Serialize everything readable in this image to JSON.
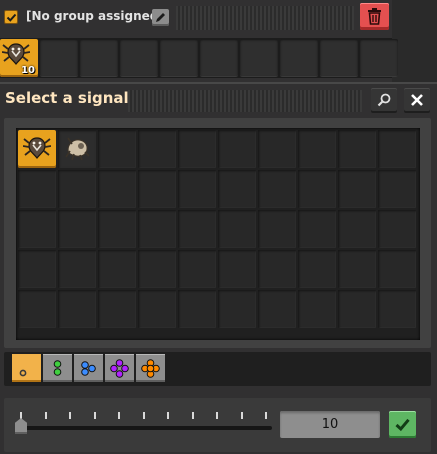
{
  "background": {
    "group": {
      "checked": true,
      "label": "[No group assigned]",
      "edit_icon": "pencil-icon",
      "delete_icon": "trash-icon"
    },
    "slots": [
      {
        "icon": "biter-signal-icon",
        "count": "10",
        "active": true
      },
      {},
      {},
      {},
      {},
      {},
      {},
      {},
      {},
      {}
    ]
  },
  "dialog": {
    "title": "Select a signal",
    "search_icon": "search-icon",
    "close_icon": "close-icon",
    "signals": [
      {
        "icon": "biter-signal-icon",
        "active": true
      },
      {
        "icon": "spitter-signal-icon",
        "active": false
      }
    ],
    "grid": {
      "columns": 10,
      "rows": 5
    },
    "quality_tabs": [
      {
        "icon": "quality-normal-icon",
        "color": "#3a3a3a",
        "active": true
      },
      {
        "icon": "quality-uncommon-icon",
        "color": "#3fcf3f",
        "active": false
      },
      {
        "icon": "quality-rare-icon",
        "color": "#3b8cff",
        "active": false
      },
      {
        "icon": "quality-epic-icon",
        "color": "#b023ff",
        "active": false
      },
      {
        "icon": "quality-legendary-icon",
        "color": "#ff8a00",
        "active": false
      }
    ],
    "slider": {
      "ticks": 11,
      "value_fraction": 0.0
    },
    "value": "10",
    "confirm_icon": "checkmark-icon"
  }
}
